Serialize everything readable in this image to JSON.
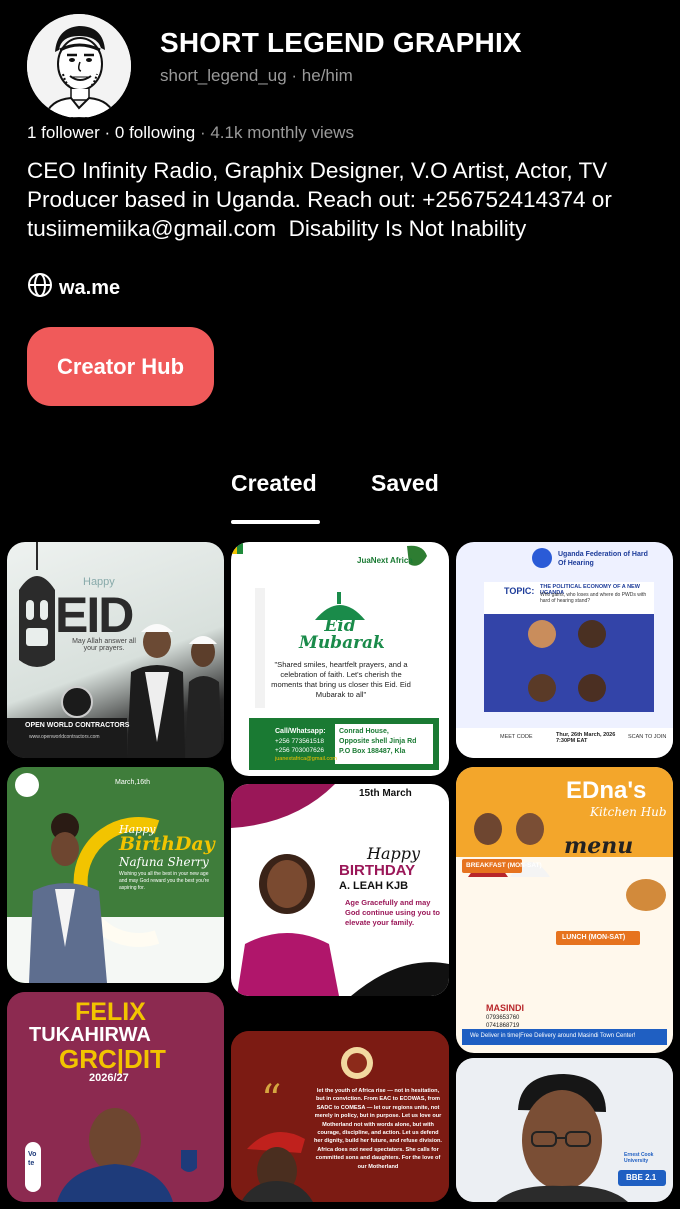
{
  "profile": {
    "display_name": "SHORT LEGEND GRAPHIX",
    "handle": "short_legend_ug",
    "pronouns": "he/him",
    "followers": "1 follower",
    "following": "0 following",
    "monthly_views": "4.1k monthly views",
    "bio": "CEO Infinity Radio, Graphix Designer, V.O Artist, Actor, TV Producer based in Uganda. Reach out: +256752414374 or tusiimemiika@gmail.com  Disability Is Not Inability",
    "website": "wa.me",
    "creator_hub_label": "Creator Hub"
  },
  "tabs": {
    "created": "Created",
    "saved": "Saved",
    "active": "created"
  },
  "pins": {
    "eid1": {
      "happy": "Happy",
      "eid": "EID",
      "sub": "May Allah answer all your prayers.",
      "company": "OPEN WORLD CONTRACTORS",
      "url": "www.openworldcontractors.com"
    },
    "eid2": {
      "brand": "JuaNext Africa",
      "title": "Eid Mubarak",
      "body": "\"Shared smiles, heartfelt prayers, and a celebration of faith. Let's cherish the moments that bring us closer this Eid. Eid Mubarak to all\"",
      "call": "Call/Whatsapp:",
      "phone1": "+256 773561518",
      "phone2": "+256 703007626",
      "email": "juanextafrica@gmail.com",
      "addr1": "Conrad House,",
      "addr2": "Opposite shell Jinja Rd",
      "addr3": "P.O Box 188487, Kla"
    },
    "ufhoh": {
      "org": "Uganda Federation of Hard Of Hearing",
      "topic": "TOPIC:",
      "topic_text": "THE POLITICAL ECONOMY OF A NEW UGANDA",
      "topic_sub": "Who gains, who loses and where do PWDs with hard of hearing stand?",
      "date": "Thur, 26th March, 2026 7:30PM EAT",
      "meet": "MEET CODE",
      "scan": "SCAN TO JOIN"
    },
    "bday1": {
      "date": "March,16th",
      "happy": "Happy",
      "birthday": "BirthDay",
      "name": "Nafuna Sherry",
      "wish": "Wishing you all the best in your new age and may God reward you the best you're aspiring for."
    },
    "bday2": {
      "date": "15th March",
      "happy": "Happy",
      "birthday": "BIRTHDAY",
      "name": "A. LEAH KJB",
      "wish": "Age Gracefully and may God continue using you to elevate your family."
    },
    "menu": {
      "title": "EDna's",
      "subtitle": "Kitchen Hub",
      "menu": "menu",
      "breakfast": "BREAKFAST (MON-SAT)",
      "lunch": "LUNCH (MON-SAT)",
      "location": "MASINDI",
      "phone1": "0793653760",
      "phone2": "0741868719",
      "footer": "We Deliver in time|Free Delivery around Masindi Town Center!"
    },
    "felix": {
      "line1": "FELIX",
      "line2": "TUKAHIRWA",
      "line3": "GRC|DIT",
      "year": "2026/27",
      "vote": "Vote"
    },
    "africa": {
      "quote": "let the youth of Africa rise — not in hesitation, but in conviction. From EAC to ECOWAS, from SADC to COMESA — let our regions unite, not merely in policy, but in purpose. Let us love our Motherland not with words alone, but with courage, discipline, and action. Let us defend her dignity, build her future, and refuse division. Africa does not need spectators. She calls for committed sons and daughters. For the love of our Motherland"
    },
    "ecu": {
      "uni": "Ernest Cook University",
      "course": "BBE 2.1"
    }
  },
  "colors": {
    "background": "#000000",
    "accent": "#f05a5a",
    "muted": "#9a9a9a"
  },
  "icons": {
    "globe": "globe-icon",
    "avatar": "avatar"
  }
}
